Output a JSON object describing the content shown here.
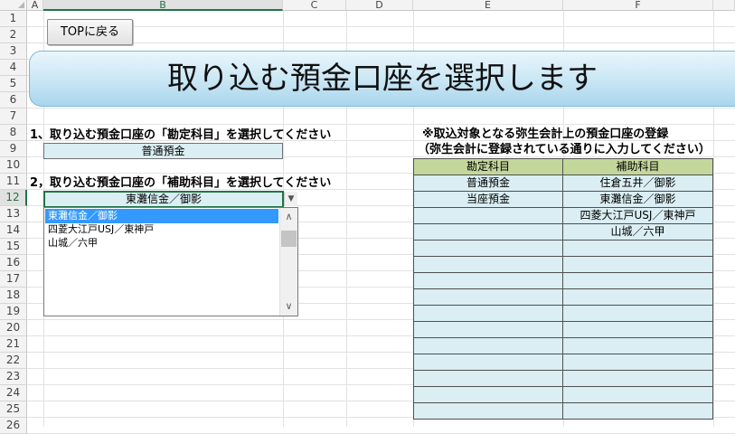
{
  "columns": [
    "A",
    "B",
    "C",
    "D",
    "E",
    "F"
  ],
  "rows": [
    "1",
    "2",
    "3",
    "4",
    "5",
    "6",
    "7",
    "8",
    "9",
    "10",
    "11",
    "12",
    "13",
    "14",
    "15",
    "16",
    "17",
    "18",
    "19",
    "20",
    "21",
    "22",
    "23",
    "24",
    "25",
    "26"
  ],
  "top_button": {
    "label": "TOPに戻る"
  },
  "banner": {
    "title": "取り込む預金口座を選択します"
  },
  "section1": {
    "label": "1、取り込む預金口座の「勘定科目」を選択してください",
    "value": "普通預金"
  },
  "section2": {
    "label": "2，取り込む預金口座の「補助科目」を選択してください",
    "value": "東灘信金／御影",
    "dropdown_arrow": "▼"
  },
  "listbox": {
    "items": [
      "東灘信金／御影",
      "四菱大江戸USJ／東神戸",
      "山城／六甲"
    ],
    "selected_index": 0,
    "scroll_up": "∧",
    "scroll_down": "∨"
  },
  "registration": {
    "title": "※取込対象となる弥生会計上の預金口座の登録",
    "subtitle": "（弥生会計に登録されている通りに入力してください）",
    "headers": [
      "勘定科目",
      "補助科目"
    ],
    "rows": [
      [
        "普通預金",
        "住倉五井／御影"
      ],
      [
        "当座預金",
        "東灘信金／御影"
      ],
      [
        "",
        "四菱大江戸USJ／東神戸"
      ],
      [
        "",
        "山城／六甲"
      ],
      [
        "",
        ""
      ],
      [
        "",
        ""
      ],
      [
        "",
        ""
      ],
      [
        "",
        ""
      ],
      [
        "",
        ""
      ],
      [
        "",
        ""
      ],
      [
        "",
        ""
      ],
      [
        "",
        ""
      ],
      [
        "",
        ""
      ],
      [
        "",
        ""
      ],
      [
        "",
        ""
      ]
    ]
  },
  "colors": {
    "accent": "#217346",
    "table_header": "#c4d79b",
    "table_cell": "#daeef3",
    "list_selected": "#3399ff"
  }
}
